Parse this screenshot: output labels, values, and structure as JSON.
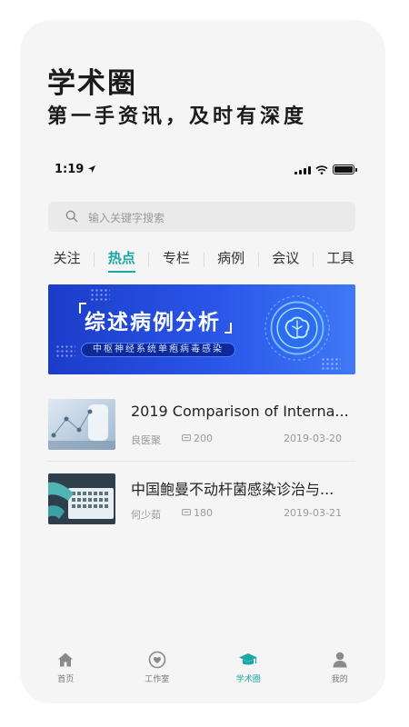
{
  "hero": {
    "title": "学术圈",
    "subtitle": "第一手资讯，及时有深度"
  },
  "status_bar": {
    "time": "1:19"
  },
  "search": {
    "placeholder": "输入关键字搜索"
  },
  "tabs": [
    {
      "label": "关注",
      "active": false
    },
    {
      "label": "热点",
      "active": true
    },
    {
      "label": "专栏",
      "active": false
    },
    {
      "label": "病例",
      "active": false
    },
    {
      "label": "会议",
      "active": false
    },
    {
      "label": "工具",
      "active": false
    }
  ],
  "banner": {
    "title": "综述病例分析",
    "subtitle": "中枢神经系统单疱病毒感染"
  },
  "articles": [
    {
      "title": "2019 Comparison of Interna...",
      "author": "良医聚",
      "comments": "200",
      "date": "2019-03-20"
    },
    {
      "title": "中国鲍曼不动杆菌感染诊治与...",
      "author": "何少茹",
      "comments": "180",
      "date": "2019-03-21"
    }
  ],
  "bottom_nav": [
    {
      "label": "首页",
      "icon": "home-icon",
      "active": false
    },
    {
      "label": "工作室",
      "icon": "heart-chat-icon",
      "active": false
    },
    {
      "label": "学术圈",
      "icon": "graduation-cap-icon",
      "active": true
    },
    {
      "label": "我的",
      "icon": "user-icon",
      "active": false
    }
  ],
  "colors": {
    "accent": "#19a8a5",
    "banner_blue": "#2a56e8",
    "card_bg": "#f5f5f5"
  }
}
